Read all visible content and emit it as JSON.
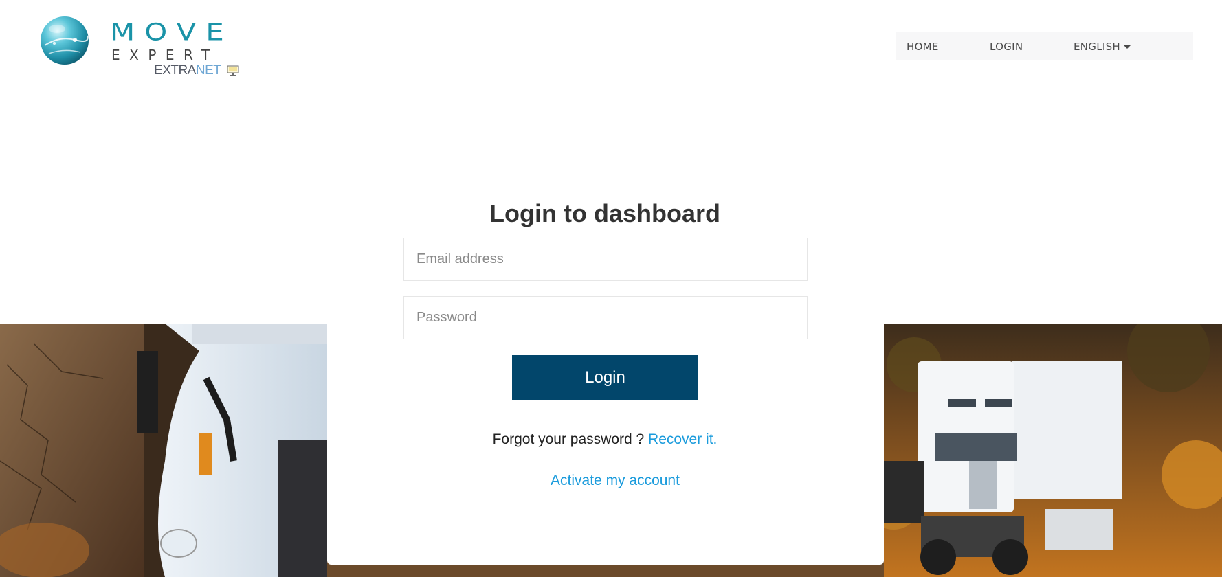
{
  "brand": {
    "name_line1": "MOVE",
    "name_line2": "EXPERT",
    "product_part1": "EXTRA",
    "product_part2": "NET",
    "colors": {
      "primary": "#1a93a8",
      "net": "#6fa7d4"
    }
  },
  "nav": {
    "items": [
      {
        "label": "HOME"
      },
      {
        "label": "LOGIN"
      }
    ],
    "language": {
      "label": "ENGLISH"
    }
  },
  "login": {
    "title": "Login to dashboard",
    "email": {
      "placeholder": "Email address",
      "value": ""
    },
    "password": {
      "placeholder": "Password",
      "value": ""
    },
    "submit_label": "Login",
    "forgot_text": "Forgot your password ?",
    "recover_link": "Recover it.",
    "activate_link": "Activate my account"
  },
  "colors": {
    "button": "#02466b",
    "link": "#1a9bdc",
    "nav_background": "#f7f7f8"
  }
}
